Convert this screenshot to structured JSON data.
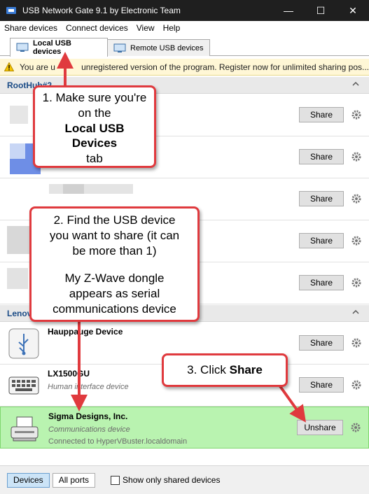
{
  "window": {
    "title": "USB Network Gate 9.1 by Electronic Team",
    "minimize_symbol": "—",
    "maximize_symbol": "☐",
    "close_symbol": "✕"
  },
  "menu": [
    "Share devices",
    "Connect devices",
    "View",
    "Help"
  ],
  "tabs": [
    {
      "label": "Local USB devices",
      "active": true,
      "icon": "usb-monitor-icon"
    },
    {
      "label": "Remote USB devices",
      "active": false,
      "icon": "remote-monitor-icon"
    }
  ],
  "warning": {
    "text_before": "You are u",
    "text_after": "unregistered version of the program. Register now for unlimited sharing pos..."
  },
  "groups": [
    {
      "name": "RootHub#2"
    },
    {
      "name": "Lenov"
    }
  ],
  "devices": [
    {
      "name": "",
      "type": "",
      "status": "",
      "button": "Share"
    },
    {
      "name": "",
      "type": "",
      "status": "",
      "button": "Share"
    },
    {
      "name": "",
      "type": "",
      "status": "",
      "button": "Share"
    },
    {
      "name": "",
      "type": "",
      "status": "",
      "button": "Share"
    },
    {
      "name": "",
      "type": "",
      "status": "",
      "button": "Share"
    },
    {
      "name": "Hauppauge Device",
      "type": "",
      "status": "",
      "button": "Share",
      "icon": "usb-icon"
    },
    {
      "name": "LX1500GU",
      "type": "Human interface device",
      "status": "",
      "button": "Share",
      "icon": "keyboard-icon"
    },
    {
      "name": "Sigma Designs, Inc.",
      "type": "Communications device",
      "status": "Connected to HyperVBuster.localdomain",
      "button": "Unshare",
      "icon": "fax-icon",
      "shared": true
    }
  ],
  "footer": {
    "devices_label": "Devices",
    "all_ports_label": "All ports",
    "show_shared_label": "Show only shared devices"
  },
  "callouts": {
    "c1": {
      "line1": "1. Make sure you're",
      "line2": "on the",
      "bold1": "Local USB",
      "bold2": "Devices",
      "line3": "tab"
    },
    "c2": {
      "line1": "2. Find the USB device",
      "line2": "you want to share (it can",
      "line3": "be more than 1)",
      "line4": "My Z-Wave dongle",
      "line5": "appears as serial",
      "line6": "communications device"
    },
    "c3": {
      "prefix": "3. Click ",
      "bold": "Share"
    }
  },
  "colors": {
    "accent_red": "#e03a3e",
    "shared_row_green": "#b9f3b0",
    "group_header_blue": "#1a4b86"
  }
}
